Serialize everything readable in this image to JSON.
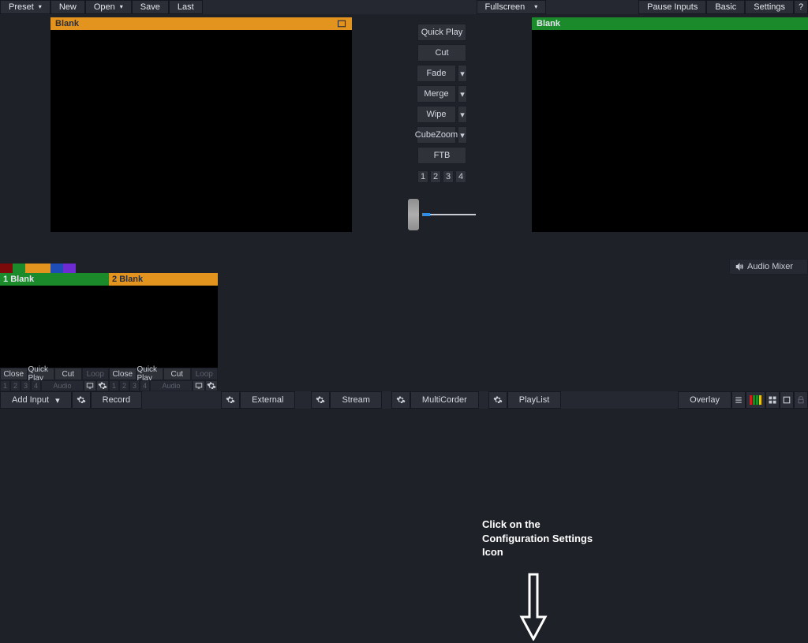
{
  "topbar": {
    "left": {
      "preset": "Preset",
      "new": "New",
      "open": "Open",
      "save": "Save",
      "last": "Last"
    },
    "center": {
      "fullscreen": "Fullscreen"
    },
    "right": {
      "pause_inputs": "Pause Inputs",
      "basic": "Basic",
      "settings": "Settings",
      "help": "?"
    }
  },
  "preview": {
    "title": "Blank"
  },
  "program": {
    "title": "Blank"
  },
  "transitions": {
    "quick_play": "Quick Play",
    "cut": "Cut",
    "fade": "Fade",
    "merge": "Merge",
    "wipe": "Wipe",
    "cube_zoom": "CubeZoom",
    "ftb": "FTB",
    "overlay_numbers": [
      "1",
      "2",
      "3",
      "4"
    ]
  },
  "swatch_colors": [
    "#7c0a0a",
    "#1a8a2b",
    "#e2941f",
    "#e2941f",
    "#1e4db7",
    "#6d2bd1"
  ],
  "inputs": [
    {
      "num": "1",
      "title": "Blank",
      "row1": [
        "Close",
        "Quick Play",
        "Cut",
        "Loop"
      ],
      "row2_nums": [
        "1",
        "2",
        "3",
        "4"
      ],
      "row2_audio": "Audio"
    },
    {
      "num": "2",
      "title": "Blank",
      "row1": [
        "Close",
        "Quick Play",
        "Cut",
        "Loop"
      ],
      "row2_nums": [
        "1",
        "2",
        "3",
        "4"
      ],
      "row2_audio": "Audio"
    }
  ],
  "audio_mixer": "Audio Mixer",
  "annotation": "Click on the Configuration Settings Icon",
  "bottombar": {
    "add_input": "Add Input",
    "record": "Record",
    "external": "External",
    "stream": "Stream",
    "multicorder": "MultiCorder",
    "playlist": "PlayList",
    "overlay": "Overlay"
  },
  "vu_colors": [
    "#d11f1f",
    "#1a8a2b",
    "#1a8a2b",
    "#e2c21f"
  ]
}
